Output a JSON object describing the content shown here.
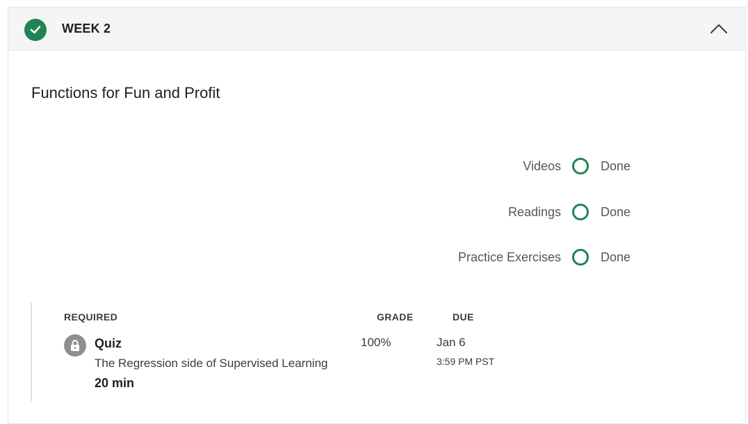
{
  "week": {
    "label": "WEEK 2",
    "completed": true
  },
  "module": {
    "title": "Functions for Fun and Profit"
  },
  "progress": [
    {
      "label": "Videos",
      "status": "Done"
    },
    {
      "label": "Readings",
      "status": "Done"
    },
    {
      "label": "Practice Exercises",
      "status": "Done"
    }
  ],
  "table": {
    "headers": {
      "required": "REQUIRED",
      "grade": "GRADE",
      "due": "DUE"
    },
    "item": {
      "type": "Quiz",
      "name": "The Regression side of Supervised Learning",
      "duration": "20 min",
      "grade": "100%",
      "due_date": "Jan 6",
      "due_time": "3:59 PM PST"
    }
  },
  "colors": {
    "accent_green": "#1f8354",
    "lock_gray": "#8f8f8f"
  },
  "icons": {
    "status": "check-circle-icon",
    "collapse": "chevron-up-icon",
    "item": "lock-icon",
    "progress": "progress-ring-icon"
  }
}
